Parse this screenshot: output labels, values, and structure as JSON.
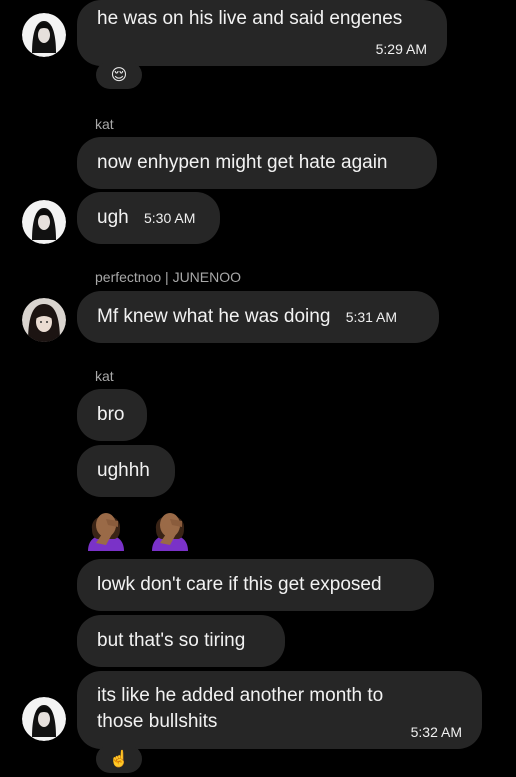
{
  "messages": {
    "m1": {
      "text": "he was on his live and said engenes",
      "time": "5:29 AM"
    },
    "m1_reaction": {
      "emoji": "😌",
      "icon": "relieved-face-icon"
    },
    "sender_kat_1": "kat",
    "m2": {
      "text": "now enhypen might get hate again"
    },
    "m3": {
      "text": "ugh",
      "time": "5:30 AM"
    },
    "sender_perfectnoo": "perfectnoo | JUNENOO",
    "m4": {
      "text": "Mf knew what he was doing",
      "time": "5:31 AM"
    },
    "sender_kat_2": "kat",
    "m5": {
      "text": "bro"
    },
    "m6": {
      "text": "ughhh"
    },
    "m7_emojis": [
      {
        "icon": "woman-facepalming-icon",
        "emoji": "🤦🏾‍♀️"
      },
      {
        "icon": "woman-facepalming-icon",
        "emoji": "🤦🏾‍♀️"
      }
    ],
    "m8": {
      "text": "lowk don't care if this get exposed"
    },
    "m9": {
      "text": "but that's so tiring"
    },
    "m10": {
      "line1": "its like he added another month to",
      "line2": "those bullshits",
      "time": "5:32 AM"
    },
    "m10_reaction": {
      "emoji": "☝️",
      "icon": "pointing-up-icon"
    }
  },
  "colors": {
    "background": "#000000",
    "bubble": "#262626",
    "sender_text": "#a8a8a8",
    "message_text": "#f2f2f2"
  }
}
